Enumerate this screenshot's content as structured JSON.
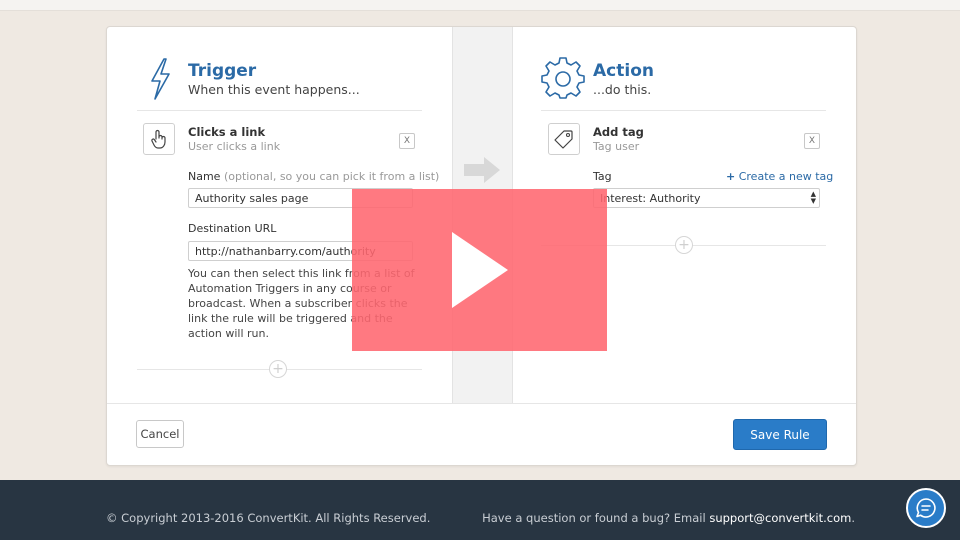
{
  "trigger": {
    "title": "Trigger",
    "subtitle": "When this event happens...",
    "item_title": "Clicks a link",
    "item_sub": "User clicks a link",
    "remove_label": "X",
    "name_label": "Name",
    "name_hint": "(optional, so you can pick it from a list)",
    "name_value": "Authority sales page",
    "url_label": "Destination URL",
    "url_value": "http://nathanbarry.com/authority",
    "help_text": "You can then select this link from a list of Automation Triggers in any course or broadcast. When a subscriber clicks the link the rule will be triggered and the action will run."
  },
  "action": {
    "title": "Action",
    "subtitle": "...do this.",
    "item_title": "Add tag",
    "item_sub": "Tag user",
    "remove_label": "X",
    "tag_label": "Tag",
    "create_tag_link": "Create a new tag",
    "tag_selected": "Interest: Authority"
  },
  "buttons": {
    "cancel": "Cancel",
    "save": "Save Rule"
  },
  "footer": {
    "copyright": "© Copyright 2013-2016 ConvertKit. All Rights Reserved.",
    "support_text": "Have a question or found a bug? Email ",
    "support_email": "support@convertkit.com",
    "support_end": "."
  },
  "colors": {
    "accent": "#2b6aa6",
    "primary_button": "#2a7cc8",
    "footer_bg": "#283542",
    "play_overlay": "#ff6670"
  },
  "icons": [
    "lightning-icon",
    "gear-icon",
    "pointer-hand-icon",
    "tag-icon",
    "arrow-right-icon",
    "plus-icon",
    "play-icon",
    "chat-icon"
  ]
}
